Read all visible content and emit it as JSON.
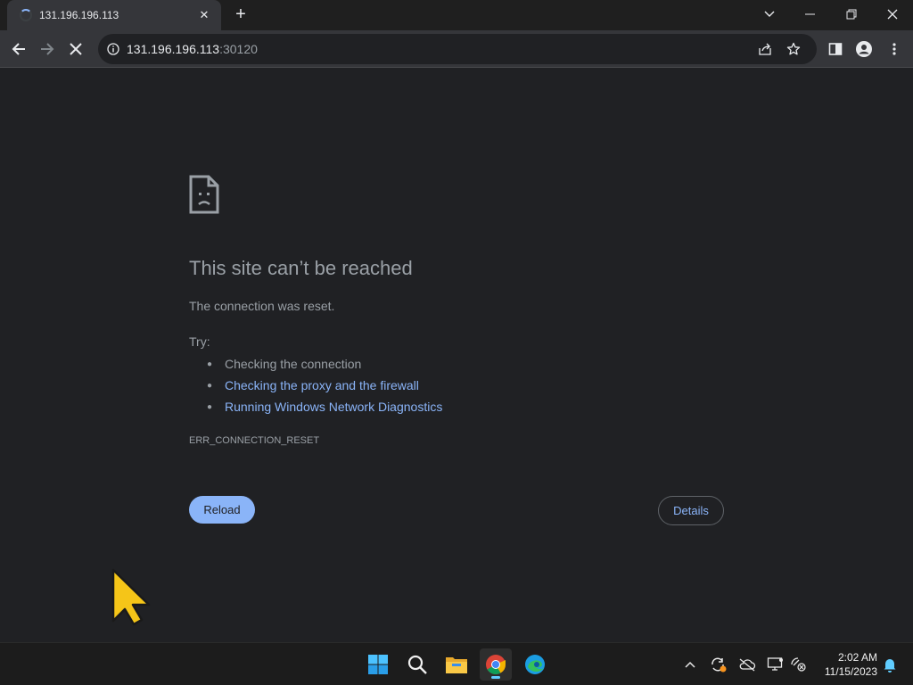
{
  "tab": {
    "title": "131.196.196.113",
    "close": "✕",
    "new_tab": "+"
  },
  "window_controls": {
    "dropdown": "⌄",
    "minimize": "—",
    "restore": "❐",
    "close": "✕"
  },
  "omnibox": {
    "host": "131.196.196.113",
    "port": ":30120"
  },
  "page": {
    "title": "This site can’t be reached",
    "message": "The connection was reset.",
    "try_label": "Try:",
    "suggestions": [
      {
        "text": "Checking the connection",
        "is_link": false
      },
      {
        "text": "Checking the proxy and the firewall",
        "is_link": true
      },
      {
        "text": "Running Windows Network Diagnostics",
        "is_link": true
      }
    ],
    "error_code": "ERR_CONNECTION_RESET",
    "reload_label": "Reload",
    "details_label": "Details"
  },
  "taskbar": {
    "apps": [
      "start-icon",
      "search-icon",
      "file-explorer-icon",
      "chrome-icon",
      "edge-icon"
    ],
    "tray": [
      "chevron-up-icon",
      "sync-icon",
      "cloud-offline-icon",
      "display-icon",
      "network-icon"
    ],
    "clock": {
      "time": "2:02 AM",
      "date": "11/15/2023"
    }
  },
  "colors": {
    "accent": "#8ab4f8",
    "background": "#202124",
    "toolbar": "#35363a",
    "cursor": "#f5c518"
  }
}
